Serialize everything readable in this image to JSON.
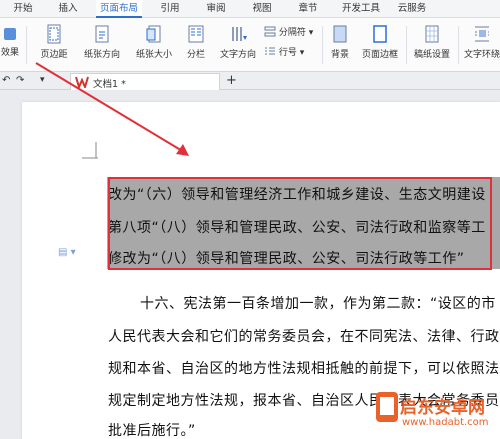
{
  "menu": {
    "tabs": [
      "开始",
      "插入",
      "页面布局",
      "引用",
      "审阅",
      "视图",
      "章节",
      "开发工具",
      "云服务"
    ],
    "active": "页面布局"
  },
  "ribbon": {
    "effects_label": "效果",
    "margins_label": "页边距",
    "orientation_label": "纸张方向",
    "size_label": "纸张大小",
    "columns_label": "分栏",
    "text_direction_label": "文字方向",
    "breaks_label": "分隔符",
    "line_numbers_label": "行号",
    "background_label": "背景",
    "page_border_label": "页面边框",
    "paper_setup_label": "稿纸设置",
    "text_wrap_label": "文字环绕"
  },
  "document_tab": {
    "name": "文档1 *"
  },
  "document": {
    "selected_lines": [
      "改为“（六）领导和管理经济工作和城乡建设、生态文明建设",
      "第八项“（八）领导和管理民政、公安、司法行政和监察等工",
      "修改为“（八）领导和管理民政、公安、司法行政等工作”"
    ],
    "body_lines": [
      "十六、宪法第一百条增加一款，作为第二款：“设区的市",
      "人民代表大会和它们的常务委员会，在不同宪法、法律、行政",
      "规和本省、自治区的地方性法规相抵触的前提下，可以依照法",
      "规定制定地方性法规，报本省、自治区人民代表大会常务委员",
      "批准后施行。”"
    ]
  },
  "watermark": {
    "title": "启东安卓网",
    "url": "www.hadabt.com"
  },
  "colors": {
    "accent": "#2a6fd6",
    "annotation": "#e0303a",
    "watermark": "#e8622a"
  }
}
